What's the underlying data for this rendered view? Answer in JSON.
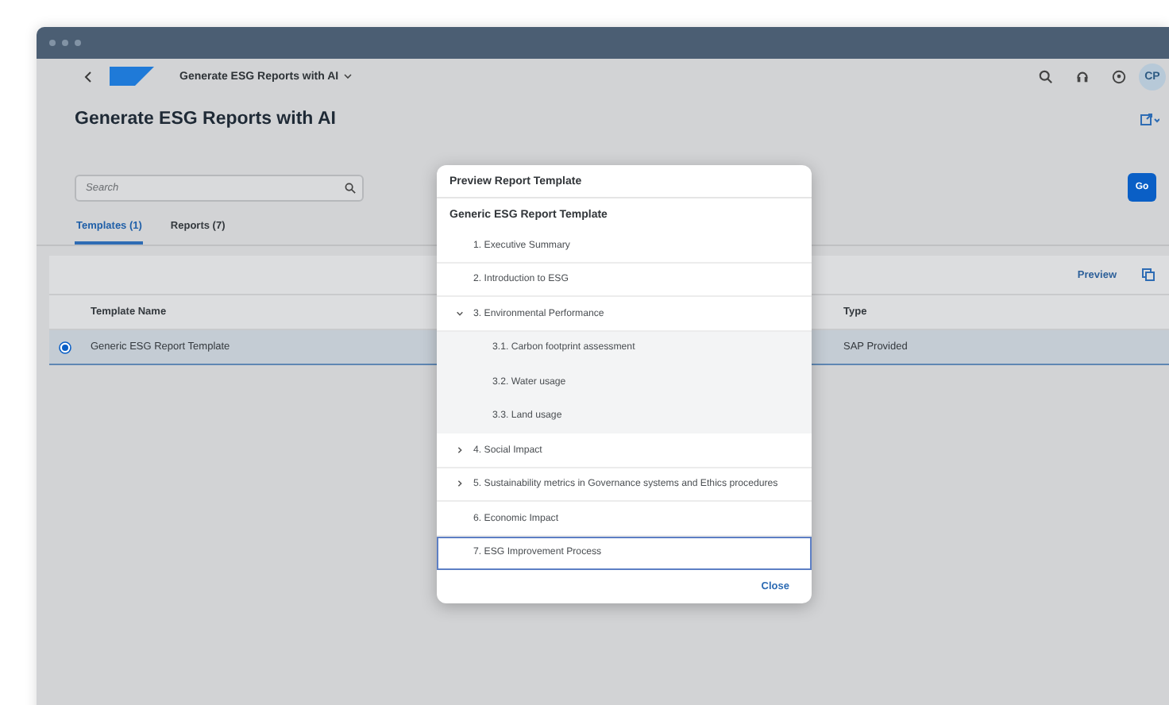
{
  "shell": {
    "title": "Generate ESG Reports with AI",
    "avatar": "CP"
  },
  "page": {
    "title": "Generate ESG Reports with AI",
    "search": {
      "placeholder": "Search"
    },
    "go_button": "Go"
  },
  "tabs": [
    {
      "label": "Templates (1)",
      "selected": true
    },
    {
      "label": "Reports (7)",
      "selected": false
    }
  ],
  "table": {
    "preview_button": "Preview",
    "columns": [
      "Template Name",
      "Type"
    ],
    "rows": [
      {
        "selected": true,
        "cells": [
          "Generic ESG Report Template",
          "SAP Provided"
        ]
      }
    ]
  },
  "dialog": {
    "title": "Preview Report Template",
    "heading": "Generic ESG Report Template",
    "items": [
      {
        "kind": "leaf",
        "label": "1. Executive Summary",
        "focused": false
      },
      {
        "kind": "leaf",
        "label": "2. Introduction to ESG",
        "focused": false
      },
      {
        "kind": "branch",
        "label": "3. Environmental Performance",
        "expanded": true,
        "focused": false,
        "children": [
          {
            "kind": "leaf",
            "label": "3.1. Carbon footprint assessment",
            "focused": false
          },
          {
            "kind": "leaf",
            "label": "3.2. Water usage",
            "focused": false
          },
          {
            "kind": "leaf",
            "label": "3.3. Land usage",
            "focused": false
          }
        ]
      },
      {
        "kind": "branch",
        "label": "4. Social Impact",
        "expanded": false,
        "focused": false
      },
      {
        "kind": "branch",
        "label": "5. Sustainability metrics in Governance systems and Ethics procedures",
        "expanded": false,
        "focused": false
      },
      {
        "kind": "leaf",
        "label": "6. Economic Impact",
        "focused": false
      },
      {
        "kind": "leaf",
        "label": "7. ESG Improvement Process",
        "focused": true
      }
    ],
    "close_button": "Close"
  }
}
